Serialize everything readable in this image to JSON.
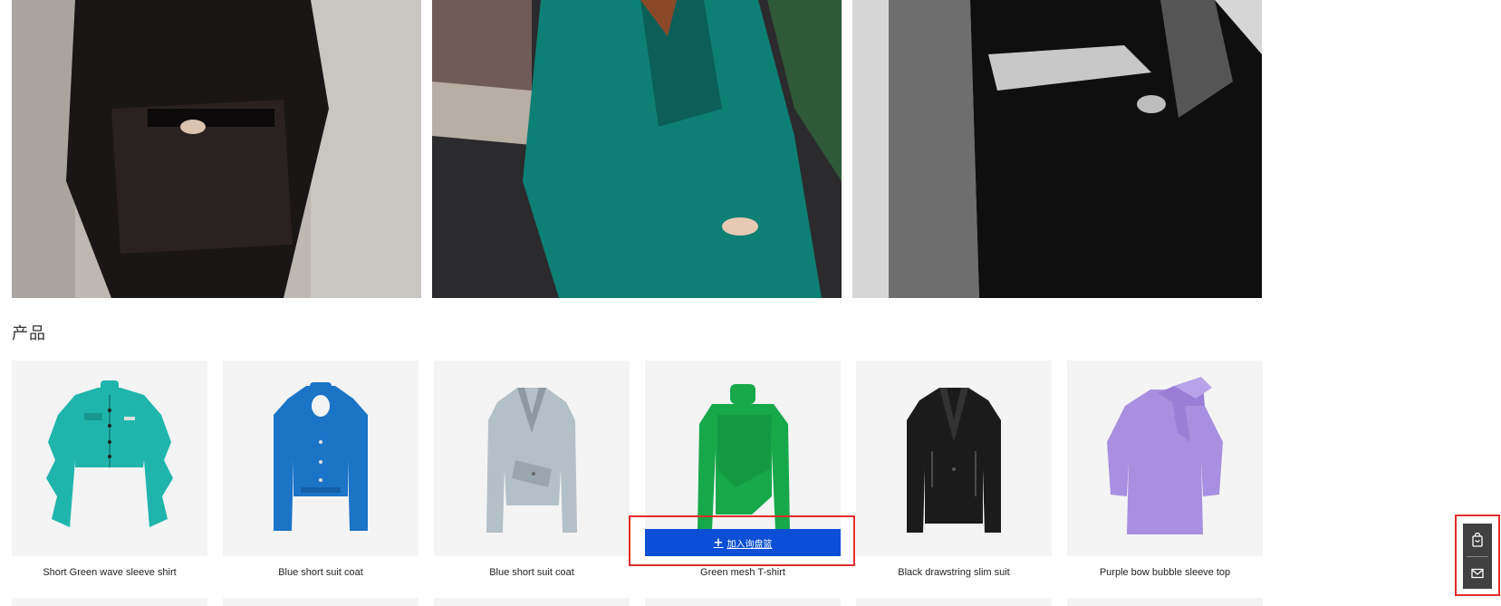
{
  "section": {
    "title": "产品"
  },
  "hero_images": [
    {
      "name": "black-leather-outfit-photo"
    },
    {
      "name": "teal-suit-photo"
    },
    {
      "name": "bw-tweed-jacket-photo"
    }
  ],
  "products": [
    {
      "name": "Short Green wave sleeve shirt",
      "color": "#1fb5ad"
    },
    {
      "name": "Blue short suit coat",
      "color": "#1c74c7"
    },
    {
      "name": "Blue short suit coat",
      "color": "#b4c0c8"
    },
    {
      "name": "Green mesh T-shirt",
      "color": "#17a84a"
    },
    {
      "name": "Black drawstring slim suit",
      "color": "#1b1b1b"
    },
    {
      "name": "Purple bow bubble sleeve top",
      "color": "#a88fe0"
    }
  ],
  "inquiry": {
    "plus": "+",
    "label": "加入询盘篮"
  },
  "side_panel": {
    "icons": [
      "shopping-bag-icon",
      "mail-icon"
    ]
  },
  "colors": {
    "accent": "#0a4fd6",
    "highlight": "#e32c2c",
    "panel": "#404040"
  }
}
